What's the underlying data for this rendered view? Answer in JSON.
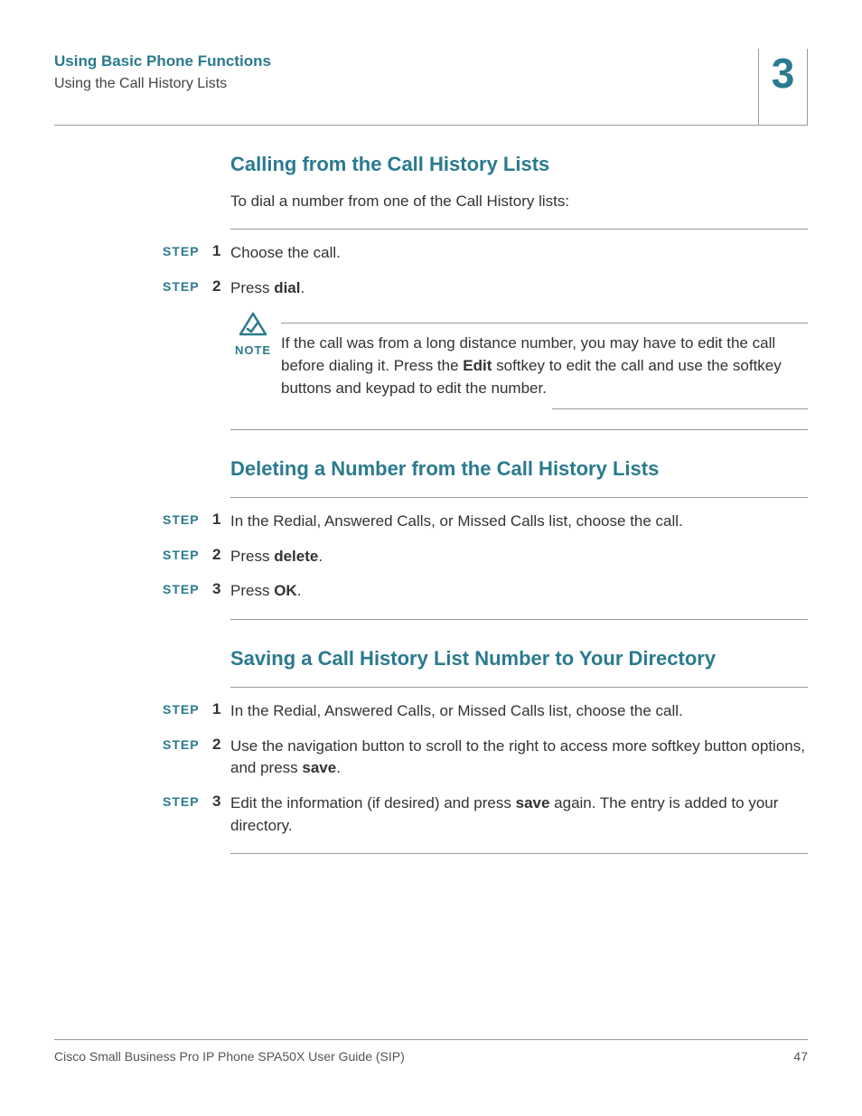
{
  "header": {
    "chapter_title": "Using Basic Phone Functions",
    "section_title": "Using the Call History Lists",
    "chapter_number": "3"
  },
  "sections": {
    "calling": {
      "title": "Calling from the Call History Lists",
      "intro": "To dial a number from one of the Call History lists:",
      "steps": [
        {
          "label": "STEP",
          "num": "1",
          "text_pre": "Choose the call.",
          "bold": "",
          "text_post": ""
        },
        {
          "label": "STEP",
          "num": "2",
          "text_pre": "Press ",
          "bold": "dial",
          "text_post": "."
        }
      ],
      "note": {
        "label": "NOTE",
        "pre": "If the call was from a long distance number, you may have to edit the call before dialing it. Press the ",
        "bold": "Edit",
        "post": " softkey to edit the call and use the softkey buttons and keypad to edit the number."
      }
    },
    "deleting": {
      "title": "Deleting a Number from the Call History Lists",
      "steps": [
        {
          "label": "STEP",
          "num": "1",
          "text_pre": "In the Redial, Answered Calls, or Missed Calls list, choose the call.",
          "bold": "",
          "text_post": ""
        },
        {
          "label": "STEP",
          "num": "2",
          "text_pre": "Press ",
          "bold": "delete",
          "text_post": "."
        },
        {
          "label": "STEP",
          "num": "3",
          "text_pre": "Press ",
          "bold": "OK",
          "text_post": "."
        }
      ]
    },
    "saving": {
      "title": "Saving a Call History List Number to Your Directory",
      "steps": [
        {
          "label": "STEP",
          "num": "1",
          "text_pre": "In the Redial, Answered Calls, or Missed Calls list, choose the call.",
          "bold": "",
          "text_post": ""
        },
        {
          "label": "STEP",
          "num": "2",
          "text_pre": "Use the navigation button to scroll to the right to access more softkey button options, and press ",
          "bold": "save",
          "text_post": "."
        },
        {
          "label": "STEP",
          "num": "3",
          "text_pre": "Edit the information (if desired) and press ",
          "bold": "save",
          "text_post": " again. The entry is added to your directory."
        }
      ]
    }
  },
  "footer": {
    "doc_title": "Cisco Small Business Pro IP Phone SPA50X User Guide (SIP)",
    "page_num": "47"
  }
}
